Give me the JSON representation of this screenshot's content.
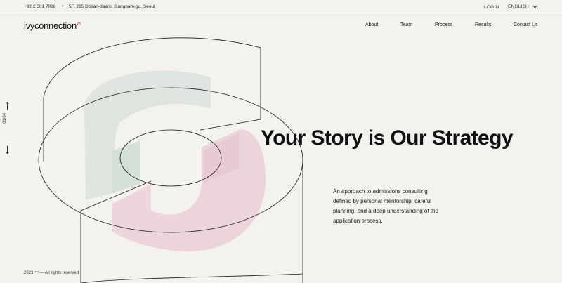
{
  "topbar": {
    "phone": "+82 2 501 7068",
    "separator": "•",
    "address": "5F, 215 Dosan-daero, Gangnam-gu, Seoul",
    "login": "LOGIN",
    "language": "ENGLISH"
  },
  "brand": {
    "logo_text": "ivyconnection",
    "accent_color": "#e05a68"
  },
  "nav": {
    "about": "About",
    "team": "Team",
    "process": "Process",
    "results": "Results",
    "contact": "Contact Us"
  },
  "slider": {
    "counter": "01/04",
    "up_icon": "arrow-up-icon",
    "down_icon": "arrow-down-icon"
  },
  "hero": {
    "headline_1": "Your ",
    "headline_2": "Story",
    "headline_3": " is Our ",
    "headline_4": "Strategy",
    "subtext": "An approach to admissions consulting defined by personal mentorship, careful planning, and a deep understanding of the application process."
  },
  "footer": {
    "note": "2023 ™  — All rights reserved"
  },
  "colors": {
    "background": "#f4f2ef",
    "green_shape": "#dde7e1",
    "pink_shape": "#efd6dc"
  }
}
